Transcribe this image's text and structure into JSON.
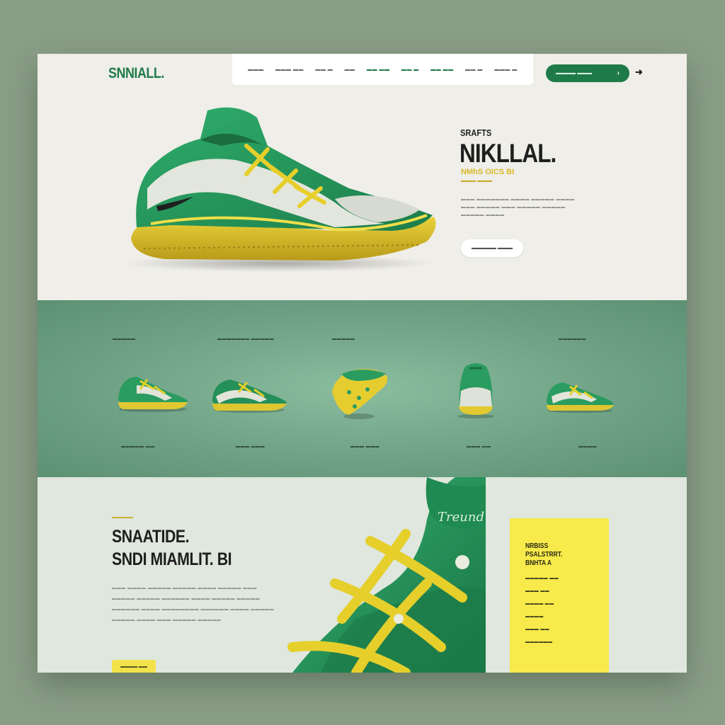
{
  "brand": {
    "logo": "SNNIALL."
  },
  "nav": {
    "items": [
      {
        "label": "▬▬▬",
        "accent": false
      },
      {
        "label": "▬▬▬ ▬▬",
        "accent": false
      },
      {
        "label": "▬▬ ▬",
        "accent": false
      },
      {
        "label": "▬▬",
        "accent": false
      },
      {
        "label": "▬▬ ▬▬",
        "accent": true
      },
      {
        "label": "▬▬ ▬",
        "accent": true
      },
      {
        "label": "▬▬ ▬▬",
        "accent": true
      },
      {
        "label": "▬▬ ▬",
        "accent": false
      },
      {
        "label": "▬▬▬ ▬",
        "accent": false
      }
    ]
  },
  "header_cta": {
    "label": "▬▬▬▬ ▬▬▬",
    "chevron": "›"
  },
  "header_arrow": "➜",
  "hero": {
    "kicker": "SRAFTS",
    "title": "NIKLLAL.",
    "subtitle": "NMhS OICS BI",
    "subtitle2": "▬▬▬ ▬▬▬",
    "body": "▬▬▬ ▬▬▬▬▬▬▬ ▬▬▬▬ ▬▬▬▬▬ ▬▬▬▬ ▬▬▬ ▬▬▬▬▬ ▬▬▬ ▬▬▬▬▬ ▬▬▬▬▬ ▬▬▬▬▬ ▬▬▬▬",
    "button": "▬▬▬▬▬ ▬▬▬"
  },
  "collection": {
    "cards": [
      {
        "top": "▬▬▬▬▬",
        "bottom": "▬▬▬▬▬ ▬▬"
      },
      {
        "top": "▬▬▬▬▬▬▬ ▬▬▬▬▬",
        "bottom": "▬▬▬ ▬▬▬"
      },
      {
        "top": "▬▬▬▬▬",
        "bottom": "▬▬▬ ▬▬▬"
      },
      {
        "top": "",
        "bottom": "▬▬▬ ▬▬"
      },
      {
        "top": "▬▬▬▬▬▬",
        "bottom": "▬▬▬▬"
      }
    ]
  },
  "feature": {
    "kicker": "▬▬▬▬▬",
    "title": "SNAATIDE.",
    "title2": "SNDI MIAMLIT. BI",
    "body": "▬▬▬ ▬▬▬▬ ▬▬▬▬▬ ▬▬▬▬▬ ▬▬▬▬ ▬▬▬▬▬ ▬▬▬ ▬▬▬▬▬ ▬▬▬▬▬ ▬▬▬▬▬▬ ▬▬▬▬ ▬▬▬▬▬ ▬▬▬▬▬ ▬▬▬▬▬▬ ▬▬▬▬ ▬▬▬▬▬▬▬▬ ▬▬▬▬▬▬ ▬▬▬▬ ▬▬▬▬▬ ▬▬▬▬▬ ▬▬▬▬ ▬▬▬ ▬▬▬▬▬ ▬▬▬▬▬",
    "button": "▬▬▬▬ ▬▬",
    "tongue_script": "Treund"
  },
  "yellow_card": {
    "title": "NRBISS PSALSTRRT. BNHTA A",
    "items": [
      "▬▬▬▬▬ ▬▬",
      "▬▬▬ ▬▬",
      "▬▬▬▬ ▬▬",
      "▬▬▬▬",
      "▬▬▬ ▬▬",
      "▬▬▬▬▬▬"
    ]
  },
  "colors": {
    "page_bg": "#8a9d87",
    "brand_green": "#1f7a4a",
    "accent_yellow": "#f2e24a",
    "strip_green": "#6d9f83"
  }
}
